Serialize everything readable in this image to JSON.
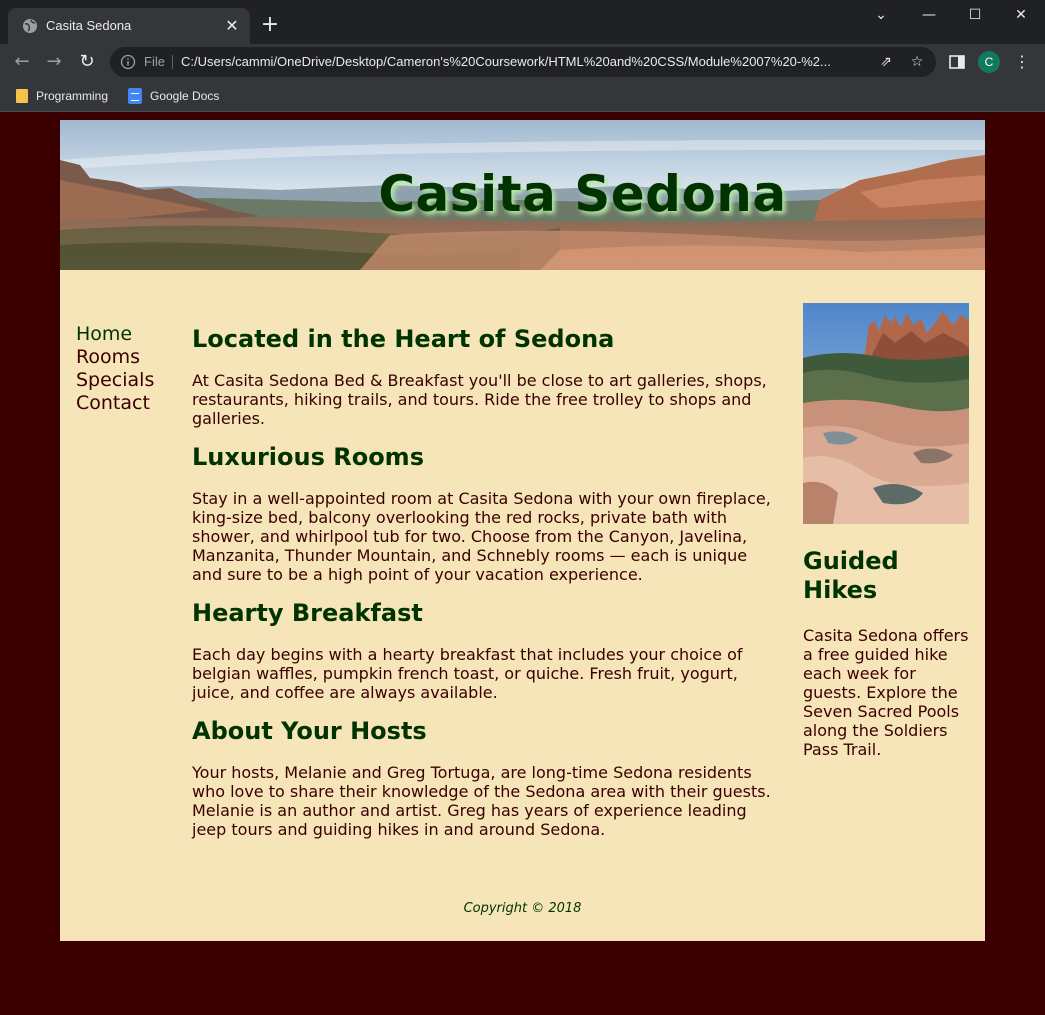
{
  "browser": {
    "tab_title": "Casita Sedona",
    "file_label": "File",
    "url": "C:/Users/cammi/OneDrive/Desktop/Cameron's%20Coursework/HTML%20and%20CSS/Module%2007%20-%2...",
    "profile_initial": "C",
    "bookmarks": [
      {
        "label": "Programming",
        "icon": "folder-icon"
      },
      {
        "label": "Google Docs",
        "icon": "google-docs-icon"
      }
    ]
  },
  "site": {
    "title": "Casita Sedona",
    "nav": [
      "Home",
      "Rooms",
      "Specials",
      "Contact"
    ],
    "sections": [
      {
        "heading": "Located in the Heart of Sedona",
        "body": "At Casita Sedona Bed & Breakfast you'll be close to art galleries, shops, restaurants, hiking trails, and tours. Ride the free trolley to shops and galleries."
      },
      {
        "heading": "Luxurious Rooms",
        "body": "Stay in a well-appointed room at Casita Sedona with your own fireplace, king-size bed, balcony overlooking the red rocks, private bath with shower, and whirlpool tub for two. Choose from the Canyon, Javelina, Manzanita, Thunder Mountain, and Schnebly rooms — each is unique and sure to be a high point of your vacation experience."
      },
      {
        "heading": "Hearty Breakfast",
        "body": "Each day begins with a hearty breakfast that includes your choice of belgian waffles, pumpkin french toast, or quiche. Fresh fruit, yogurt, juice, and coffee are always available."
      },
      {
        "heading": "About Your Hosts",
        "body": "Your hosts, Melanie and Greg Tortuga, are long-time Sedona residents who love to share their knowledge of the Sedona area with their guests. Melanie is an author and artist. Greg has years of experience leading jeep tours and guiding hikes in and around Sedona."
      }
    ],
    "aside": {
      "heading": "Guided Hikes",
      "body": "Casita Sedona offers a free guided hike each week for guests. Explore the Seven Sacred Pools along the Soldiers Pass Trail."
    },
    "footer": "Copyright © 2018"
  },
  "colors": {
    "page_background": "#3a0000",
    "content_background": "#f5e5b8",
    "heading_green": "#003300",
    "text_maroon": "#3a0000"
  }
}
